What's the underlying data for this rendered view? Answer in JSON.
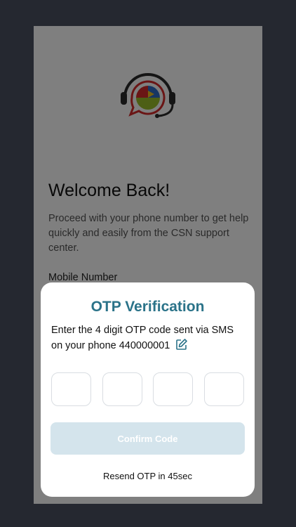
{
  "login": {
    "welcome_title": "Welcome Back!",
    "description": "Proceed with your phone number to get help quickly and easily from the CSN support center.",
    "mobile_label": "Mobile Number",
    "logo_icon": "csn-headset-chat-logo"
  },
  "otp_sheet": {
    "title": "OTP Verification",
    "message": "Enter the 4 digit OTP code sent via SMS on your phone 440000001",
    "edit_icon": "edit-pencil-icon",
    "otp_digits": [
      "",
      "",
      "",
      ""
    ],
    "confirm_label": "Confirm Code",
    "resend_text": "Resend OTP in 45sec"
  },
  "colors": {
    "backdrop": "#252830",
    "accent": "#2b7389",
    "button_disabled": "#d4e4ec"
  }
}
